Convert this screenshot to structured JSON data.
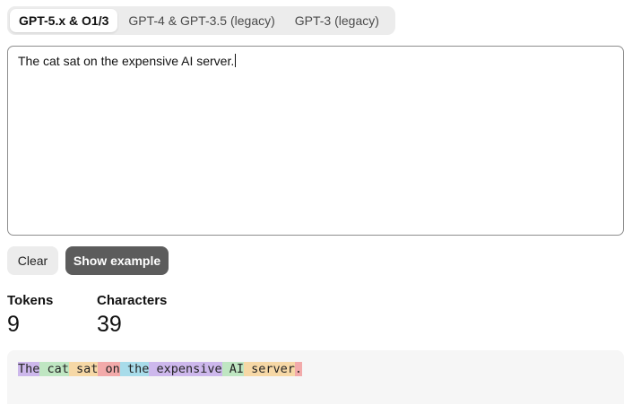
{
  "tabs": [
    {
      "label": "GPT-5.x & O1/3",
      "active": true
    },
    {
      "label": "GPT-4 & GPT-3.5 (legacy)",
      "active": false
    },
    {
      "label": "GPT-3 (legacy)",
      "active": false
    }
  ],
  "input": {
    "value": "The cat sat on the expensive AI server."
  },
  "buttons": {
    "clear": "Clear",
    "show_example": "Show example"
  },
  "stats": {
    "tokens_label": "Tokens",
    "tokens_value": "9",
    "characters_label": "Characters",
    "characters_value": "39"
  },
  "tokens": [
    {
      "text": "The",
      "color": "#cdb8ec"
    },
    {
      "text": " cat",
      "color": "#bfe6c2"
    },
    {
      "text": " sat",
      "color": "#f6d8a6"
    },
    {
      "text": " on",
      "color": "#f2aaaa"
    },
    {
      "text": " the",
      "color": "#a8dcea"
    },
    {
      "text": " expensive",
      "color": "#cdb8ec"
    },
    {
      "text": " AI",
      "color": "#bfe6c2"
    },
    {
      "text": " server",
      "color": "#f6d8a6"
    },
    {
      "text": ".",
      "color": "#f2aaaa"
    }
  ]
}
